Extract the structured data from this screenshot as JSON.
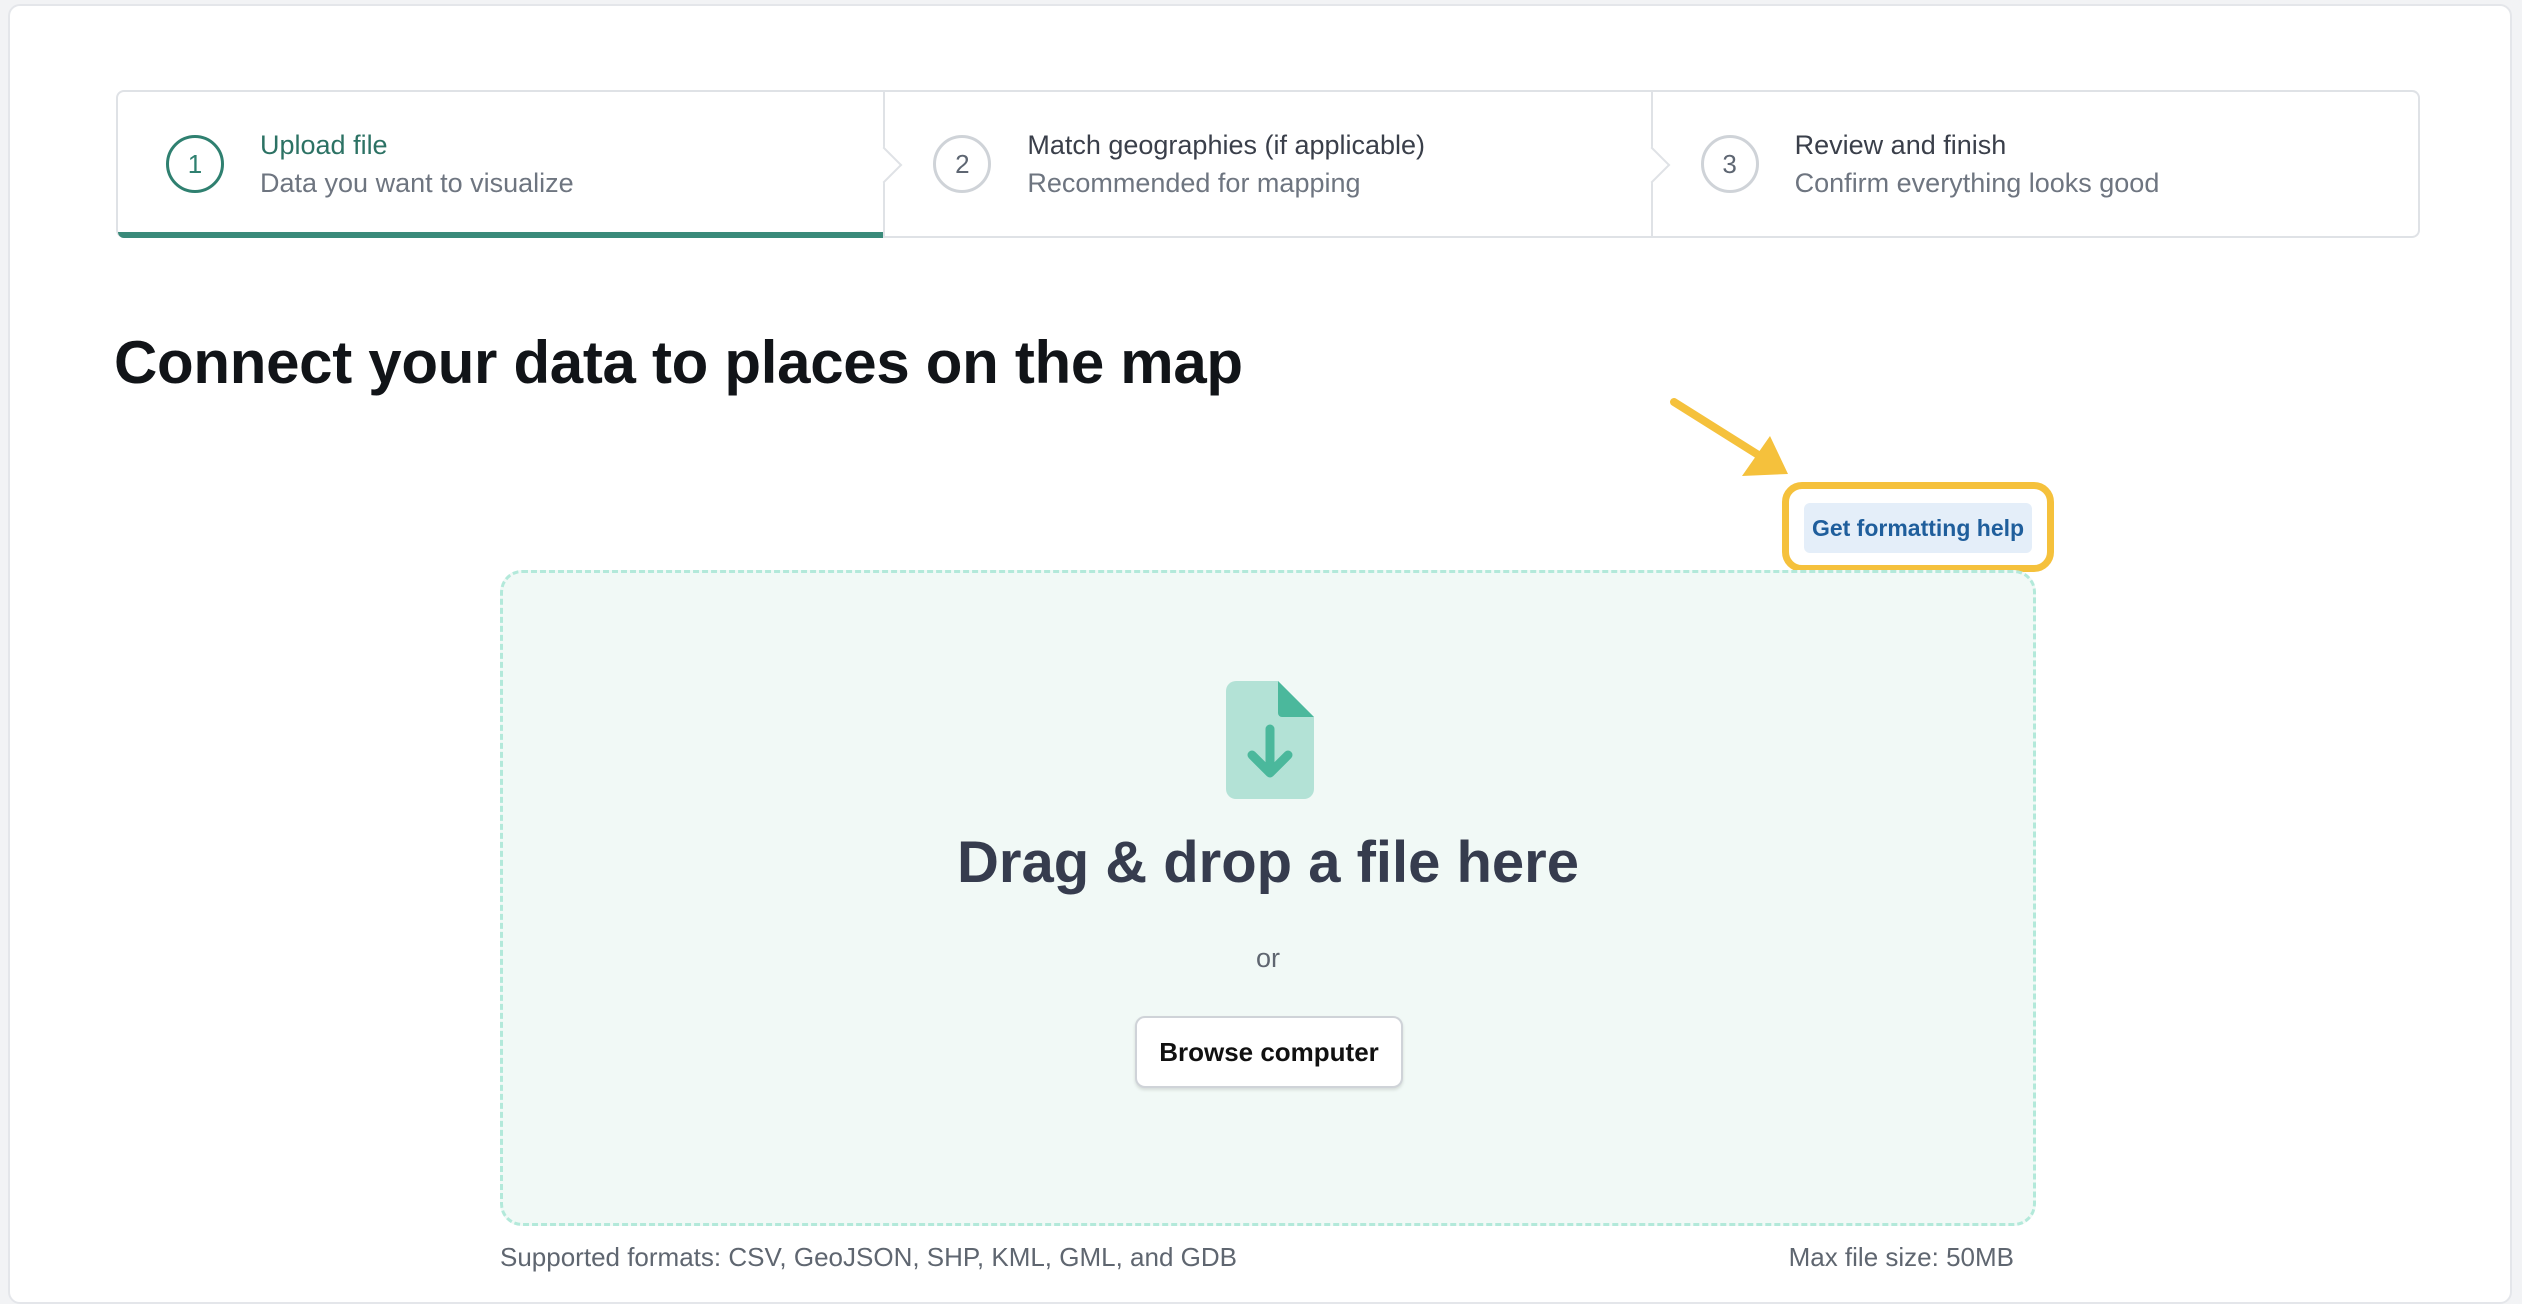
{
  "steps": [
    {
      "number": "1",
      "title": "Upload file",
      "subtitle": "Data you want to visualize",
      "active": true
    },
    {
      "number": "2",
      "title": "Match geographies (if applicable)",
      "subtitle": "Recommended for mapping",
      "active": false
    },
    {
      "number": "3",
      "title": "Review and finish",
      "subtitle": "Confirm everything looks good",
      "active": false
    }
  ],
  "page_title": "Connect your data to places on the map",
  "help_button_label": "Get formatting help",
  "dropzone": {
    "icon": "file-download-icon",
    "title": "Drag & drop a file here",
    "or_text": "or",
    "browse_label": "Browse computer"
  },
  "footer": {
    "supported_formats": "Supported formats: CSV, GeoJSON, SHP, KML, GML, and GDB",
    "max_size": "Max file size: 50MB"
  },
  "colors": {
    "accent": "#2f8070",
    "highlight": "#f5c13c",
    "dropzone_bg": "#f1f9f6",
    "help_button_bg": "#e4eef9"
  }
}
